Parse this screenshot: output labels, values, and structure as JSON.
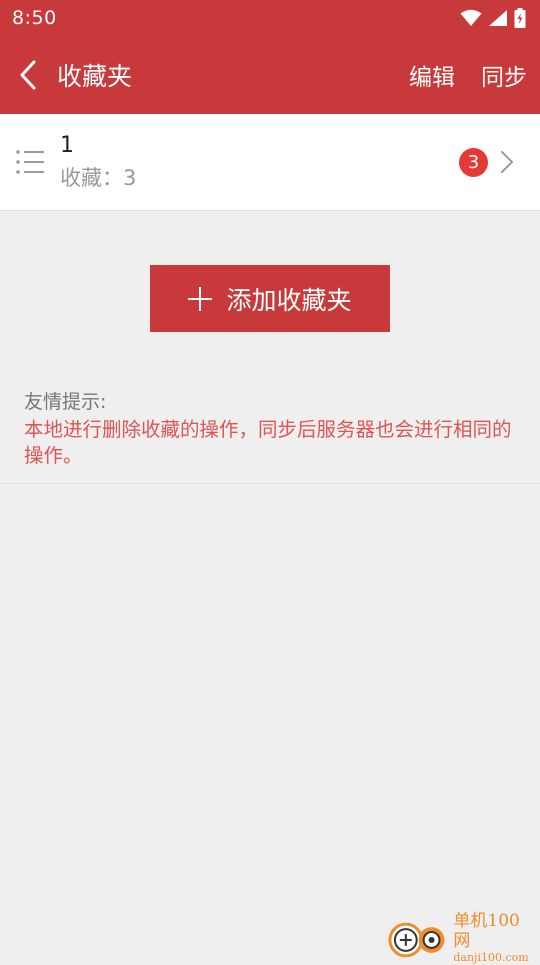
{
  "status_bar": {
    "time": "8:50",
    "icons": [
      "wifi-icon",
      "signal-icon",
      "battery-charging-icon"
    ]
  },
  "app_bar": {
    "title": "收藏夹",
    "actions": {
      "edit": "编辑",
      "sync": "同步"
    },
    "icons": {
      "back": "chevron-left-icon"
    },
    "color": "#c8393b"
  },
  "folders": [
    {
      "name": "1",
      "subtitle": "收藏：3",
      "badge": "3"
    }
  ],
  "add_button": {
    "label": "添加收藏夹",
    "icon": "plus-icon"
  },
  "tips": {
    "title": "友情提示:",
    "text": "本地进行删除收藏的操作，同步后服务器也会进行相同的操作。"
  },
  "watermark": {
    "cn": "单机100网",
    "en": "danji100.com"
  },
  "colors": {
    "accent": "#c8393b",
    "badge": "#e53935",
    "tip_text": "#e05454",
    "watermark": "#ef8d2b"
  }
}
